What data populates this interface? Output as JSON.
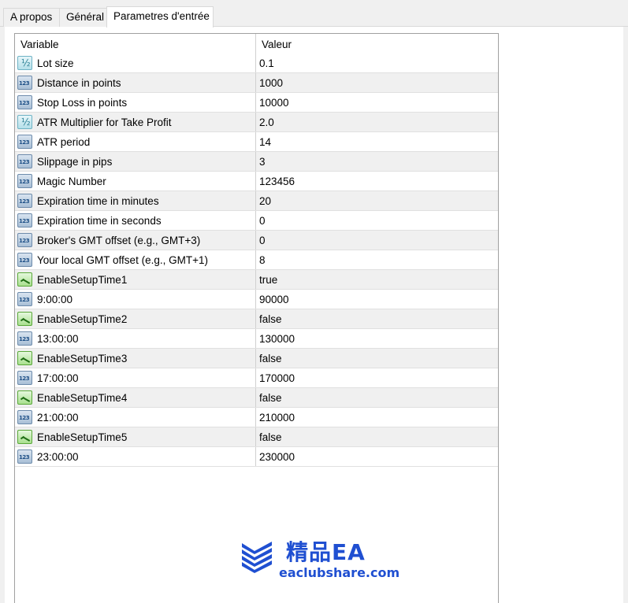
{
  "tabs": [
    {
      "label": "A propos"
    },
    {
      "label": "Général"
    },
    {
      "label": "Parametres d'entrée",
      "active": true
    }
  ],
  "grid": {
    "columns": [
      "Variable",
      "Valeur"
    ],
    "rows": [
      {
        "icon": "double-type-icon",
        "name": "Lot size",
        "value": "0.1"
      },
      {
        "icon": "integer-type-icon",
        "name": "Distance in points",
        "value": "1000"
      },
      {
        "icon": "integer-type-icon",
        "name": "Stop Loss in points",
        "value": "10000"
      },
      {
        "icon": "double-type-icon",
        "name": "ATR Multiplier for Take Profit",
        "value": "2.0"
      },
      {
        "icon": "integer-type-icon",
        "name": "ATR period",
        "value": "14"
      },
      {
        "icon": "integer-type-icon",
        "name": "Slippage in pips",
        "value": "3"
      },
      {
        "icon": "integer-type-icon",
        "name": "Magic Number",
        "value": "123456"
      },
      {
        "icon": "integer-type-icon",
        "name": "Expiration time in minutes",
        "value": "20"
      },
      {
        "icon": "integer-type-icon",
        "name": "Expiration time in seconds",
        "value": "0"
      },
      {
        "icon": "integer-type-icon",
        "name": "Broker's GMT offset (e.g., GMT+3)",
        "value": "0"
      },
      {
        "icon": "integer-type-icon",
        "name": "Your local GMT offset (e.g., GMT+1)",
        "value": "8"
      },
      {
        "icon": "bool-type-icon",
        "name": "EnableSetupTime1",
        "value": "true"
      },
      {
        "icon": "integer-type-icon",
        "name": "9:00:00",
        "value": "90000"
      },
      {
        "icon": "bool-type-icon",
        "name": "EnableSetupTime2",
        "value": "false"
      },
      {
        "icon": "integer-type-icon",
        "name": "13:00:00",
        "value": "130000"
      },
      {
        "icon": "bool-type-icon",
        "name": "EnableSetupTime3",
        "value": "false"
      },
      {
        "icon": "integer-type-icon",
        "name": "17:00:00",
        "value": "170000"
      },
      {
        "icon": "bool-type-icon",
        "name": "EnableSetupTime4",
        "value": "false"
      },
      {
        "icon": "integer-type-icon",
        "name": "21:00:00",
        "value": "210000"
      },
      {
        "icon": "bool-type-icon",
        "name": "EnableSetupTime5",
        "value": "false"
      },
      {
        "icon": "integer-type-icon",
        "name": "23:00:00",
        "value": "230000"
      }
    ]
  },
  "watermark": {
    "brand": "精品EA",
    "url": "eaclubshare.com",
    "color": "#1f4fd1"
  }
}
